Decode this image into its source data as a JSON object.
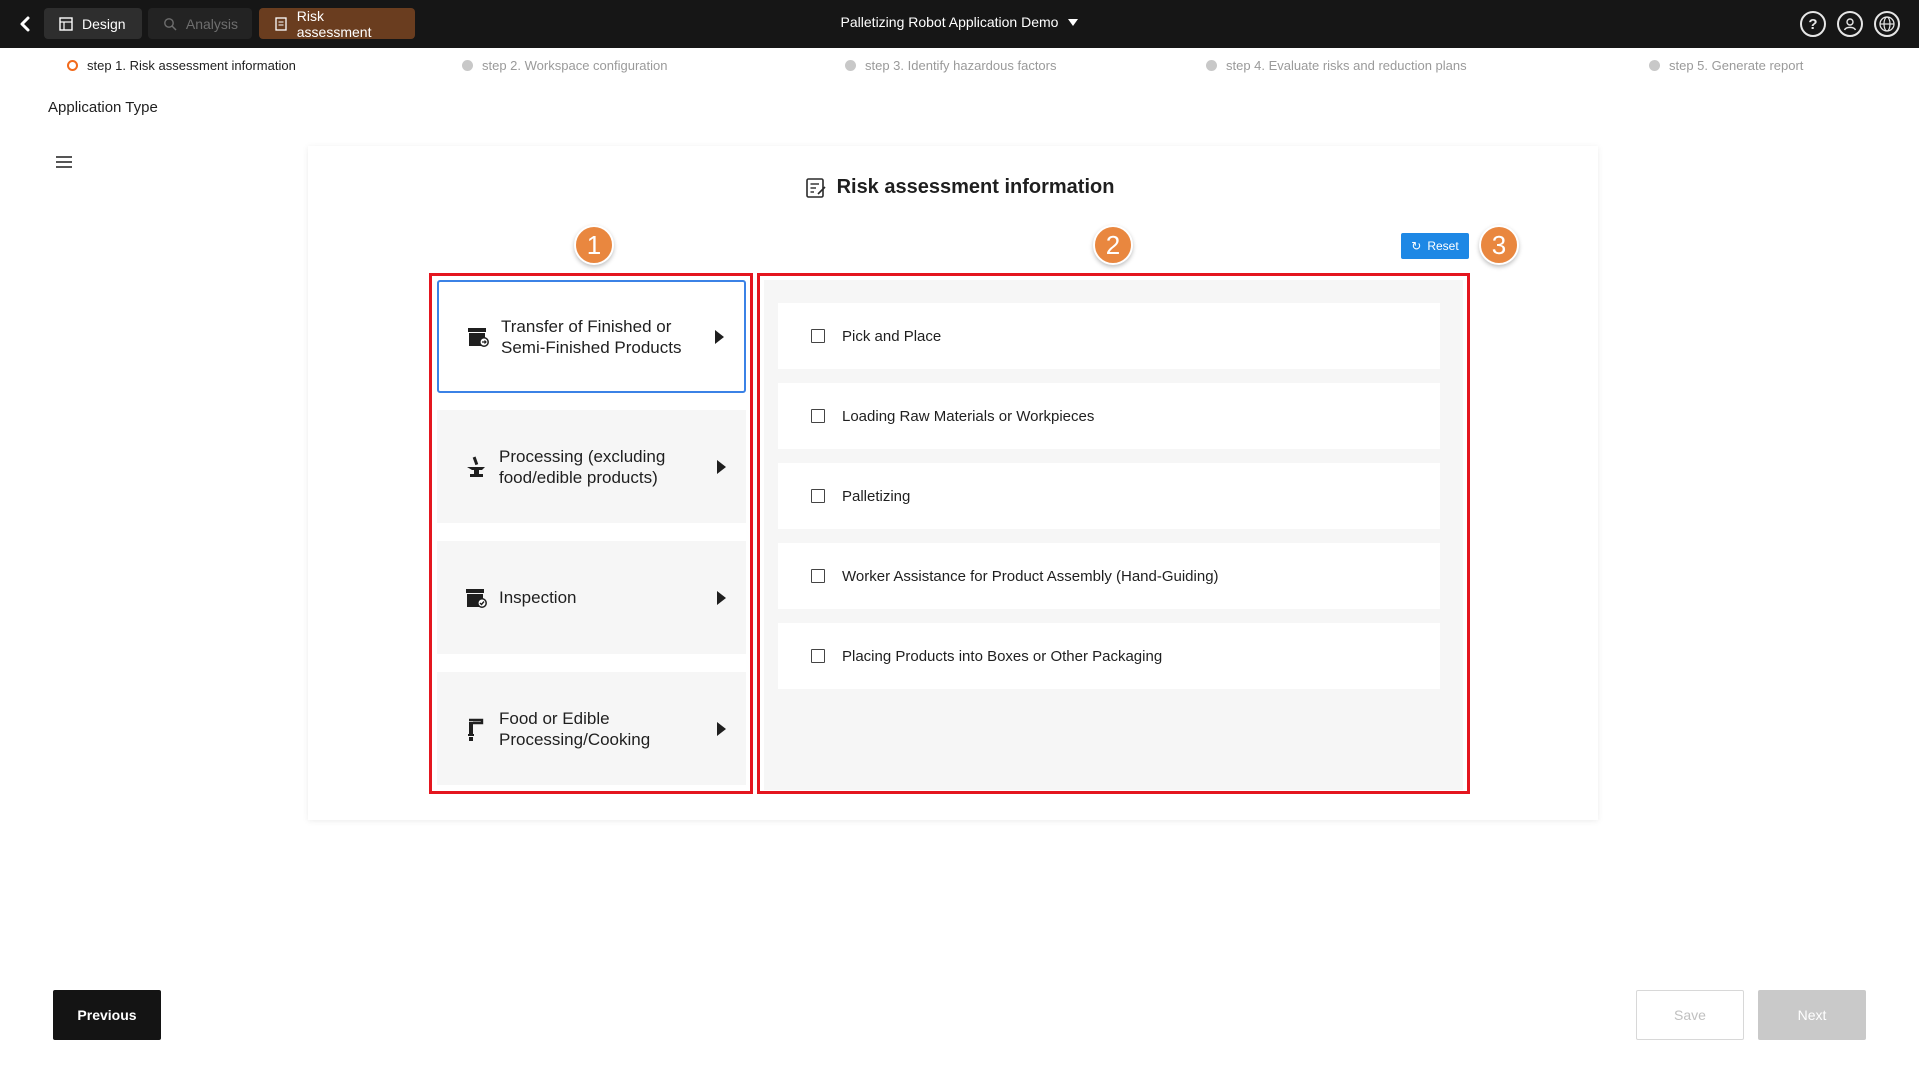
{
  "topbar": {
    "tabs": [
      {
        "label": "Design",
        "icon": "layout-icon"
      },
      {
        "label": "Analysis",
        "icon": "analysis-search-icon"
      },
      {
        "label": "Risk assessment",
        "icon": "document-icon"
      }
    ],
    "project_title": "Palletizing Robot Application Demo",
    "icons": [
      "help-icon",
      "user-icon",
      "globe-icon"
    ]
  },
  "steps": [
    {
      "label": "step 1. Risk assessment information",
      "active": true
    },
    {
      "label": "step 2. Workspace configuration",
      "active": false
    },
    {
      "label": "step 3. Identify hazardous factors",
      "active": false
    },
    {
      "label": "step 4. Evaluate risks and reduction plans",
      "active": false
    },
    {
      "label": "step 5. Generate report",
      "active": false
    }
  ],
  "page": {
    "section_label": "Application Type",
    "card_title": "Risk assessment information",
    "reset_label": "Reset",
    "callouts": [
      "1",
      "2",
      "3"
    ]
  },
  "categories": [
    {
      "label": "Transfer of Finished or Semi-Finished Products",
      "icon": "box-transfer-icon",
      "selected": true
    },
    {
      "label": "Processing (excluding food/edible products)",
      "icon": "anvil-icon",
      "selected": false
    },
    {
      "label": "Inspection",
      "icon": "box-check-icon",
      "selected": false
    },
    {
      "label": "Food or Edible Processing/Cooking",
      "icon": "food-arm-icon",
      "selected": false
    }
  ],
  "options": [
    {
      "label": "Pick and Place",
      "checked": false
    },
    {
      "label": "Loading Raw Materials or Workpieces",
      "checked": false
    },
    {
      "label": "Palletizing",
      "checked": false
    },
    {
      "label": "Worker Assistance for Product Assembly (Hand-Guiding)",
      "checked": false
    },
    {
      "label": "Placing Products into Boxes or Other Packaging",
      "checked": false
    }
  ],
  "footer": {
    "previous_label": "Previous",
    "save_label": "Save",
    "next_label": "Next"
  },
  "colors": {
    "topbar_bg": "#161616",
    "active_tab_bg": "#6a3d1f",
    "active_step_dot": "#f26a1b",
    "callout": "#e9873f",
    "highlight_box": "#e4161f",
    "reset_button": "#1e88e5",
    "selected_border": "#3b82e6"
  }
}
